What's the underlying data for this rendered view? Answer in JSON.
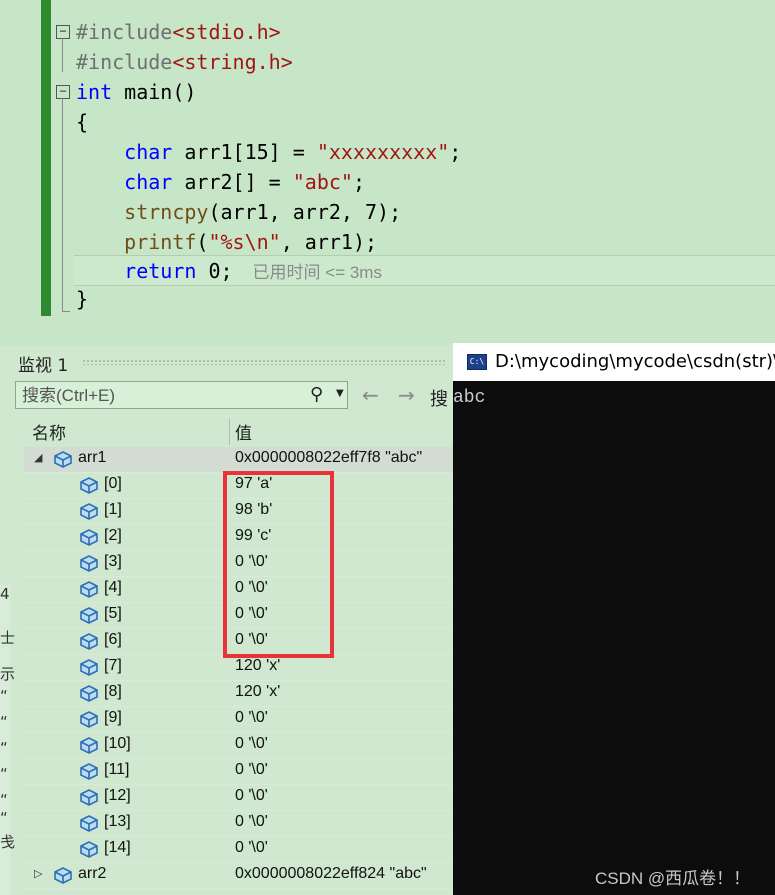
{
  "editor": {
    "lines": [
      {
        "parts": [
          {
            "t": "#include",
            "c": "pp"
          },
          {
            "t": "<stdio.h>",
            "c": "str"
          }
        ]
      },
      {
        "parts": [
          {
            "t": "#include",
            "c": "pp"
          },
          {
            "t": "<string.h>",
            "c": "str"
          }
        ]
      },
      {
        "parts": [
          {
            "t": "int",
            "c": "kw"
          },
          {
            "t": " main()",
            "c": "plain"
          }
        ]
      },
      {
        "parts": [
          {
            "t": "{",
            "c": "plain"
          }
        ]
      },
      {
        "parts": [
          {
            "t": "    char",
            "c": "kw"
          },
          {
            "t": " arr1[15] = ",
            "c": "plain"
          },
          {
            "t": "\"xxxxxxxxx\"",
            "c": "str"
          },
          {
            "t": ";",
            "c": "plain"
          }
        ]
      },
      {
        "parts": [
          {
            "t": "    char",
            "c": "kw"
          },
          {
            "t": " arr2[] = ",
            "c": "plain"
          },
          {
            "t": "\"abc\"",
            "c": "str"
          },
          {
            "t": ";",
            "c": "plain"
          }
        ]
      },
      {
        "parts": [
          {
            "t": "    strncpy",
            "c": "fn"
          },
          {
            "t": "(arr1, arr2, 7);",
            "c": "plain"
          }
        ]
      },
      {
        "parts": [
          {
            "t": "    printf",
            "c": "fn"
          },
          {
            "t": "(",
            "c": "plain"
          },
          {
            "t": "\"%s\\n\"",
            "c": "str"
          },
          {
            "t": ", arr1);",
            "c": "plain"
          }
        ]
      },
      {
        "parts": [
          {
            "t": "    return",
            "c": "kw"
          },
          {
            "t": " 0;",
            "c": "plain"
          }
        ],
        "hint": "已用时间 <= 3ms"
      },
      {
        "parts": [
          {
            "t": "}",
            "c": "plain"
          }
        ]
      }
    ]
  },
  "watch": {
    "title": "监视 1",
    "search_placeholder": "搜索(Ctrl+E)",
    "search_depth_label": "搜",
    "col_name": "名称",
    "col_value": "值",
    "rows": [
      {
        "name": "arr1",
        "value": "0x0000008022eff7f8 \"abc\"",
        "level": 0,
        "expander": "◢",
        "selected": true
      },
      {
        "name": "[0]",
        "value": "97 'a'",
        "level": 1
      },
      {
        "name": "[1]",
        "value": "98 'b'",
        "level": 1
      },
      {
        "name": "[2]",
        "value": "99 'c'",
        "level": 1
      },
      {
        "name": "[3]",
        "value": "0 '\\0'",
        "level": 1
      },
      {
        "name": "[4]",
        "value": "0 '\\0'",
        "level": 1
      },
      {
        "name": "[5]",
        "value": "0 '\\0'",
        "level": 1
      },
      {
        "name": "[6]",
        "value": "0 '\\0'",
        "level": 1
      },
      {
        "name": "[7]",
        "value": "120 'x'",
        "level": 1
      },
      {
        "name": "[8]",
        "value": "120 'x'",
        "level": 1
      },
      {
        "name": "[9]",
        "value": "0 '\\0'",
        "level": 1
      },
      {
        "name": "[10]",
        "value": "0 '\\0'",
        "level": 1
      },
      {
        "name": "[11]",
        "value": "0 '\\0'",
        "level": 1
      },
      {
        "name": "[12]",
        "value": "0 '\\0'",
        "level": 1
      },
      {
        "name": "[13]",
        "value": "0 '\\0'",
        "level": 1
      },
      {
        "name": "[14]",
        "value": "0 '\\0'",
        "level": 1
      },
      {
        "name": "arr2",
        "value": "0x0000008022eff824 \"abc\"",
        "level": 0,
        "expander": "▷"
      }
    ]
  },
  "console": {
    "title": "D:\\mycoding\\mycode\\csdn(str)\\x",
    "icon_text": "C:\\",
    "output": "abc"
  },
  "left_fragments": [
    "4",
    "士",
    "示",
    "“",
    "“",
    "“",
    "“",
    "“",
    "“",
    "戋"
  ],
  "watermark": "CSDN @西瓜卷！！",
  "colors": {
    "highlight": "#e8333a",
    "editor_bg": "#c7e6c7",
    "console_bg": "#0c0c0c"
  }
}
